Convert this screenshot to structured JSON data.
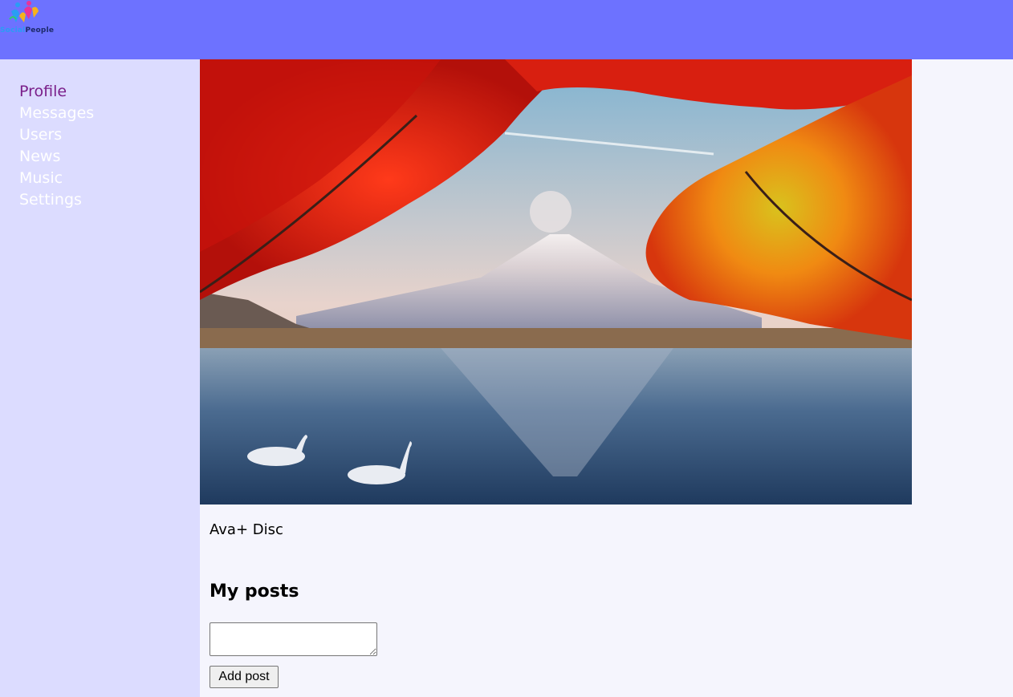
{
  "header": {
    "logo_text_part1": "Social",
    "logo_text_part2": "People",
    "background_color": "#6d72ff"
  },
  "sidebar": {
    "background_color": "#dcdcff",
    "items": [
      {
        "label": "Profile",
        "active": true
      },
      {
        "label": "Messages",
        "active": false
      },
      {
        "label": "Users",
        "active": false
      },
      {
        "label": "News",
        "active": false
      },
      {
        "label": "Music",
        "active": false
      },
      {
        "label": "Settings",
        "active": false
      }
    ],
    "active_color": "#7a1f8a"
  },
  "profile": {
    "hero_image": "mount-fuji-autumn-landscape-photo",
    "description": "Ava+ Disc"
  },
  "posts": {
    "title": "My posts",
    "input_value": "",
    "add_button_label": "Add post"
  }
}
